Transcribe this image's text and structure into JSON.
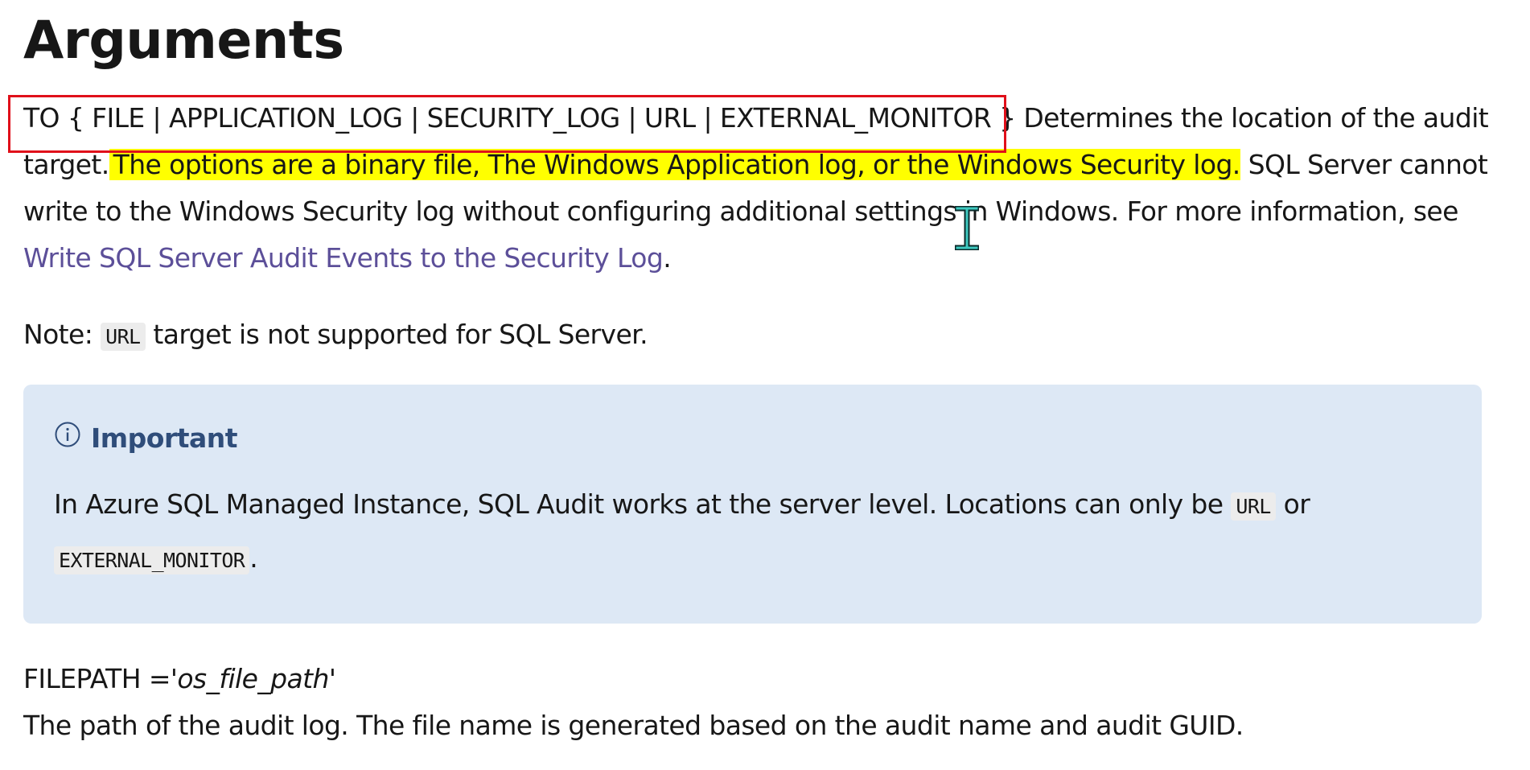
{
  "heading": "Arguments",
  "to_arg": {
    "syntax": "TO { FILE | APPLICATION_LOG | SECURITY_LOG | URL | EXTERNAL_MONITOR }",
    "text_before_highlight": " Determines the location of the audit target.",
    "highlighted": "The options are a binary file, The Windows Application log, or the Windows Security log.",
    "text_after_highlight": " SQL Server cannot write to the Windows Security log without configuring additional settings in Windows. For more information, see ",
    "link_text": "Write SQL Server Audit Events to the Security Log",
    "after_link": "."
  },
  "note": {
    "prefix": "Note: ",
    "code": "URL",
    "suffix": " target is not supported for SQL Server."
  },
  "alert": {
    "icon": "info-icon",
    "title": "Important",
    "body_before": "In Azure SQL Managed Instance, SQL Audit works at the server level. Locations can only be ",
    "code1": "URL",
    "between": " or ",
    "code2": "EXTERNAL_MONITOR",
    "after": "."
  },
  "filepath": {
    "label": "FILEPATH ='",
    "param": "os_file_path",
    "close": "'",
    "description": "The path of the audit log. The file name is generated based on the audit name and audit GUID."
  },
  "colors": {
    "highlight": "#ffff00",
    "link": "#5c4f99",
    "alert_bg": "#dde8f5",
    "alert_title": "#2f4d7a",
    "annotation_box": "#e0101a"
  }
}
